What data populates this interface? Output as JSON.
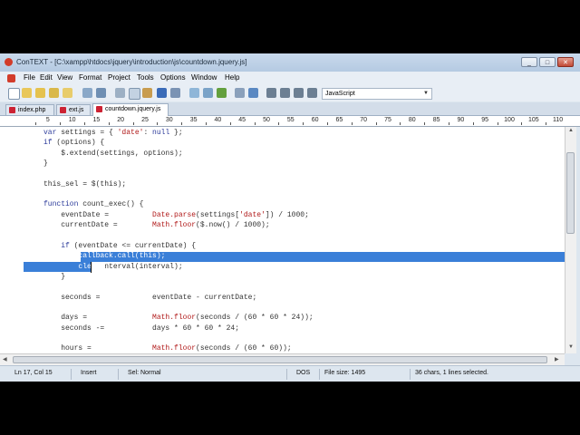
{
  "window": {
    "app_name": "ConTEXT",
    "title": "ConTEXT - [C:\\xampp\\htdocs\\jquery\\introduction\\js\\countdown.jquery.js]",
    "controls": {
      "minimize": "_",
      "maximize": "□",
      "close": "✕"
    }
  },
  "menu": [
    "File",
    "Edit",
    "View",
    "Format",
    "Project",
    "Tools",
    "Options",
    "Window",
    "Help"
  ],
  "toolbar": {
    "language": "JavaScript",
    "icons": [
      "new-file-icon",
      "open-icon",
      "save-icon",
      "save-all-icon",
      "folder-icon",
      "print-icon",
      "print-preview-icon",
      "cut-icon",
      "copy-icon",
      "paste-icon",
      "delete-icon",
      "undo-icon",
      "redo-icon",
      "find-icon",
      "find-next-icon",
      "replace-icon",
      "options-icon",
      "tools-icon",
      "user-1-icon",
      "user-2-icon",
      "user-3-icon",
      "user-4-icon"
    ],
    "accent_colors": {
      "brand": "#d23c2a",
      "selection": "#3a7fd8"
    }
  },
  "tabs": [
    {
      "label": "index.php",
      "active": false
    },
    {
      "label": "ext.js",
      "active": false
    },
    {
      "label": "countdown.jquery.js",
      "active": true
    }
  ],
  "ruler": [
    "5",
    "10",
    "15",
    "20",
    "25",
    "30",
    "35",
    "40",
    "45",
    "50",
    "55",
    "60",
    "65",
    "70",
    "75",
    "80",
    "85",
    "90",
    "95",
    "100",
    "105",
    "110"
  ],
  "code": [
    "var settings = { 'date': null };",
    "if (options) {",
    "    $.extend(settings, options);",
    "}",
    "",
    "this_sel = $(this);",
    "",
    "function count_exec() {",
    "    eventDate =          Date.parse(settings['date']) / 1000;",
    "    currentDate =        Math.floor($.now() / 1000);",
    "",
    "    if (eventDate <= currentDate) {",
    "        callback.call(this);",
    "        clearInterval(interval);",
    "    }",
    "",
    "    seconds =            eventDate - currentDate;",
    "",
    "    days =               Math.floor(seconds / (60 * 60 * 24));",
    "    seconds -=           days * 60 * 60 * 24;",
    "",
    "    hours =              Math.floor(seconds / (60 * 60));"
  ],
  "status": {
    "position": "Ln 17, Col 15",
    "mode": "Insert",
    "selection_mode": "Sel: Normal",
    "line_endings": "DOS",
    "file_size": "File size: 1495",
    "selection_info": "36 chars, 1 lines selected."
  }
}
